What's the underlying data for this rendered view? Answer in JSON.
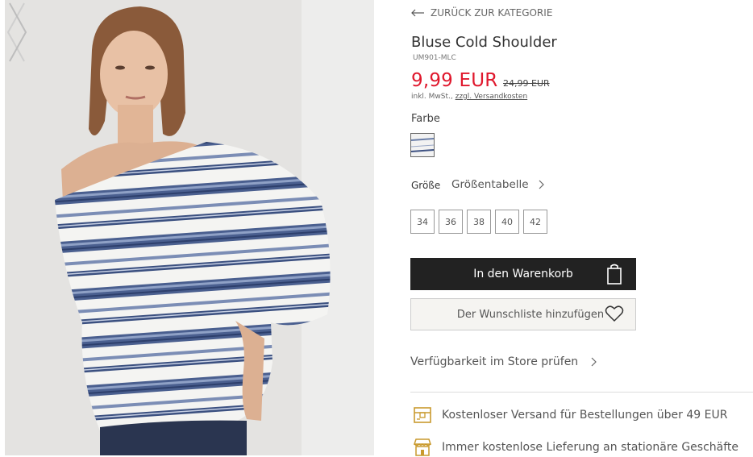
{
  "gallery": {
    "prev_icon": "chevron-left-icon",
    "next_icon": "chevron-right-icon"
  },
  "product": {
    "back_label": "ZURÜCK ZUR KATEGORIE",
    "title": "Bluse Cold Shoulder",
    "sku": "UM901-MLC",
    "price": "9,99 EUR",
    "old_price": "24,99 EUR",
    "tax_text": "inkl. MwSt., ",
    "shipping_link": "zzgl. Versandkosten",
    "color_label": "Farbe",
    "size_label": "Größe",
    "size_chart_label": "Größentabelle",
    "sizes": [
      "34",
      "36",
      "38",
      "40",
      "42"
    ],
    "cart_button": "In den Warenkorb",
    "wishlist_button": "Der Wunschliste hinzufügen",
    "store_check": "Verfügbarkeit im Store prüfen",
    "info": [
      {
        "icon": "delivery-box-icon",
        "text": "Kostenloser Versand für Bestellungen über 49 EUR"
      },
      {
        "icon": "store-icon",
        "text": "Immer kostenlose Lieferung an stationäre Geschäfte"
      }
    ]
  },
  "colors": {
    "price_red": "#e0182d",
    "button_dark": "#222222",
    "icon_gold": "#c99a2e"
  }
}
